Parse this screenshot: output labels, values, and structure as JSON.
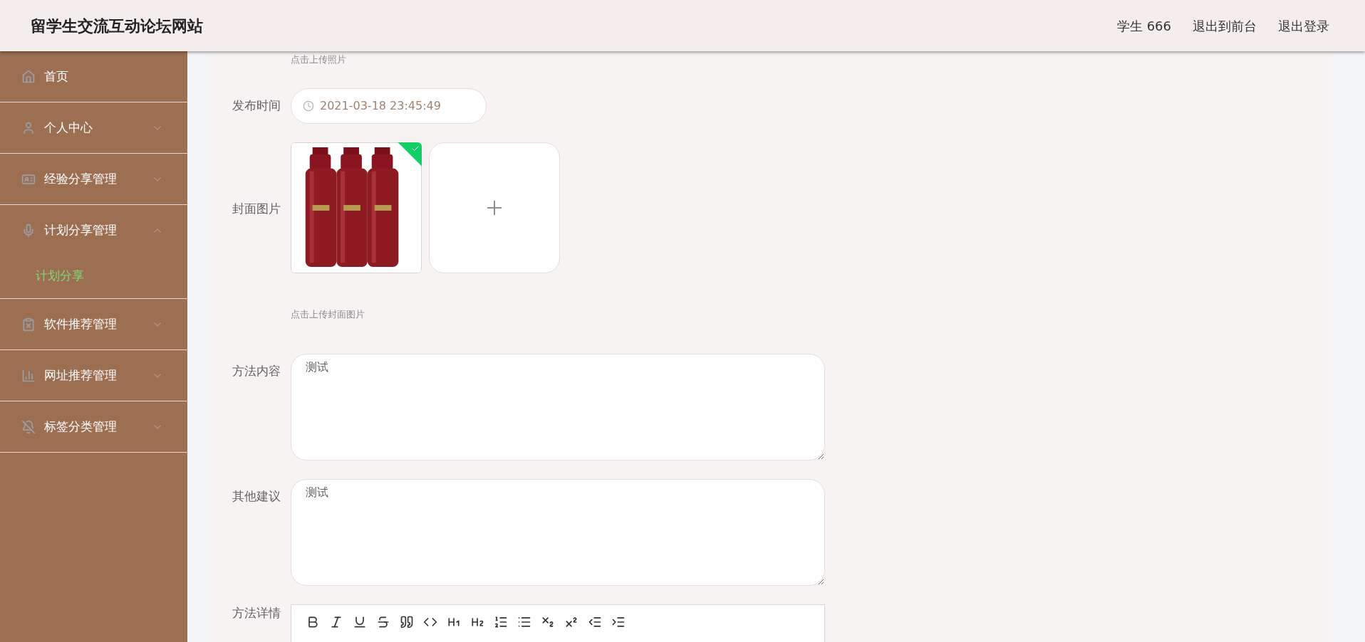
{
  "header": {
    "title": "留学生交流互动论坛网站",
    "user": "学生 666",
    "links": [
      "退出到前台",
      "退出登录"
    ]
  },
  "sidebar": {
    "items": [
      {
        "label": "首页"
      },
      {
        "label": "个人中心",
        "expanded": false
      },
      {
        "label": "经验分享管理",
        "expanded": false
      },
      {
        "label": "计划分享管理",
        "expanded": true,
        "children": [
          {
            "label": "计划分享",
            "selected": true
          }
        ]
      },
      {
        "label": "软件推荐管理",
        "expanded": false
      },
      {
        "label": "网址推荐管理",
        "expanded": false
      },
      {
        "label": "标签分类管理",
        "expanded": false
      }
    ]
  },
  "form": {
    "top_hint": "点击上传照片",
    "fields": [
      {
        "kind": "date",
        "label": "发布时间",
        "value": "2021-03-18 23:45:49"
      },
      {
        "label": "封面图片",
        "hint": "点击上传封面图片"
      },
      {
        "kind": "textarea",
        "label": "方法内容",
        "value": "测试"
      },
      {
        "kind": "textarea",
        "label": "其他建议",
        "value": "测试"
      },
      {
        "kind": "editor",
        "label": "方法详情"
      }
    ]
  }
}
